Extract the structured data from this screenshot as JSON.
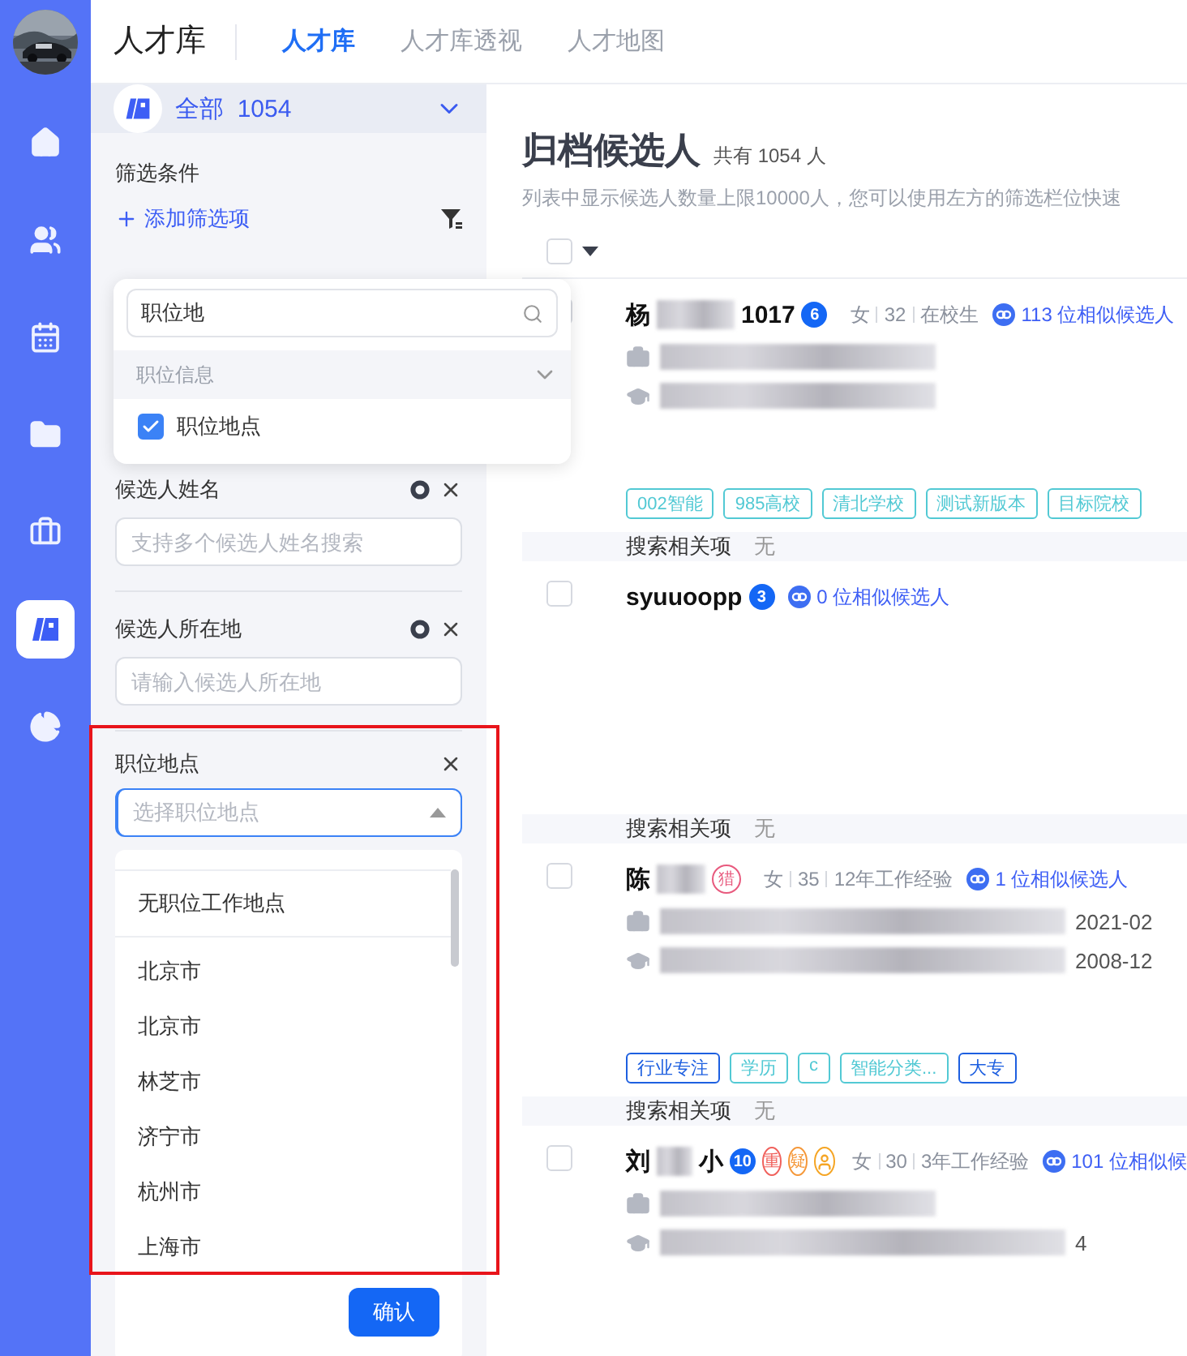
{
  "nav": {
    "items": [
      {
        "kind": "home",
        "selected": false
      },
      {
        "kind": "people",
        "selected": false
      },
      {
        "kind": "calendar",
        "selected": false
      },
      {
        "kind": "folder",
        "selected": false
      },
      {
        "kind": "briefcase",
        "selected": false
      },
      {
        "kind": "library",
        "selected": true
      },
      {
        "kind": "chart",
        "selected": false
      }
    ]
  },
  "header": {
    "title": "人才库",
    "tabs": [
      {
        "label": "人才库",
        "selected": true
      },
      {
        "label": "人才库透视",
        "selected": false
      },
      {
        "label": "人才地图",
        "selected": false
      }
    ]
  },
  "filter": {
    "scope": "全部",
    "count": "1054",
    "title": "筛选条件",
    "add_label": "添加筛选项",
    "popup": {
      "query": "职位地",
      "group": "职位信息",
      "options": [
        {
          "label": "职位地点",
          "checked": true
        }
      ]
    },
    "fields": [
      {
        "label": "候选人姓名",
        "placeholder": "支持多个候选人姓名搜索",
        "kind": "text"
      },
      {
        "label": "候选人所在地",
        "placeholder": "请输入候选人所在地",
        "kind": "text"
      },
      {
        "label": "职位地点",
        "placeholder": "选择职位地点",
        "kind": "select",
        "expanded": true
      }
    ],
    "dropdown": {
      "options": [
        "无职位工作地点",
        "北京市",
        "北京市",
        "林芝市",
        "济宁市",
        "杭州市",
        "上海市"
      ],
      "confirm": "确认"
    }
  },
  "main": {
    "title": "归档候选人",
    "count": "共有 1054 人",
    "hint": "列表中显示候选人数量上限10000人，您可以使用左方的筛选栏位快速",
    "select_all": {
      "checked": false
    },
    "candidates": [
      {
        "name": "杨",
        "name_tail": "1017",
        "count": "6",
        "meta": [
          "女",
          "32",
          "在校生"
        ],
        "similar": "113 位相似候选人",
        "details": [
          {
            "kind": "work"
          },
          {
            "kind": "education"
          }
        ],
        "tags": [
          {
            "label": "002智能",
            "color": "#52c9d4"
          },
          {
            "label": "985高校",
            "color": "#52c9d4"
          },
          {
            "label": "清北学校",
            "color": "#52c9d4"
          },
          {
            "label": "测试新版本",
            "color": "#52c9d4"
          },
          {
            "label": "目标院校",
            "color": "#52c9d4"
          }
        ],
        "relevance_label": "搜索相关项",
        "relevance": "无",
        "checked": false
      },
      {
        "name": "syuuoopp",
        "count": "3",
        "similar": "0 位相似候选人",
        "relevance_label": "搜索相关项",
        "relevance": "无",
        "checked": false
      },
      {
        "name": "陈",
        "markers": [
          {
            "kind": "text",
            "label": "猎",
            "color": "#e85a7e"
          }
        ],
        "meta": [
          "女",
          "35",
          "12年工作经验"
        ],
        "similar": "1 位相似候选人",
        "details": [
          {
            "kind": "work",
            "tail": "2021-02"
          },
          {
            "kind": "education",
            "tail": "2008-12"
          }
        ],
        "tags": [
          {
            "label": "行业专注",
            "color": "#1d5fe0"
          },
          {
            "label": "学历",
            "color": "#52c9d4"
          },
          {
            "label": "c",
            "color": "#52c9d4"
          },
          {
            "label": "智能分类...",
            "color": "#52c9d4"
          },
          {
            "label": "大专",
            "color": "#1d5fe0"
          }
        ],
        "relevance_label": "搜索相关项",
        "relevance": "无",
        "checked": false
      },
      {
        "name": "刘",
        "name_tail": "小",
        "count": "10",
        "markers": [
          {
            "kind": "text",
            "label": "重",
            "color": "#f0615c"
          },
          {
            "kind": "text",
            "label": "疑",
            "color": "#f5983a"
          },
          {
            "kind": "person",
            "color": "#f5a524"
          }
        ],
        "meta": [
          "女",
          "30",
          "3年工作经验"
        ],
        "similar": "101 位相似候",
        "details": [
          {
            "kind": "work"
          },
          {
            "kind": "education",
            "tail": "4"
          }
        ],
        "checked": false
      }
    ]
  }
}
